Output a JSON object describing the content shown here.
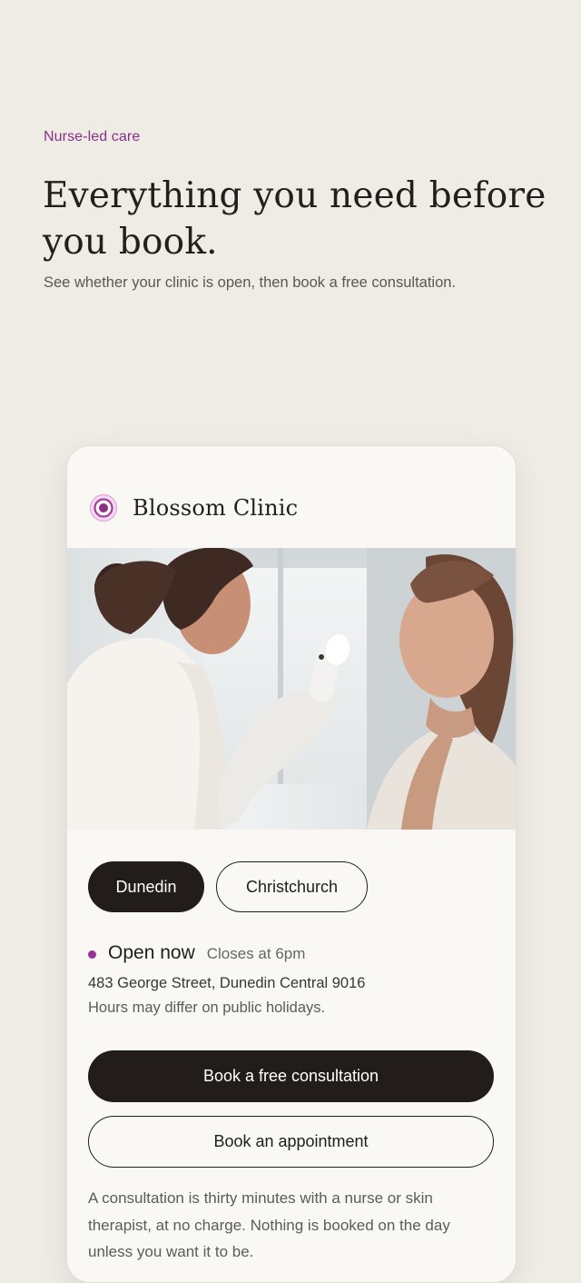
{
  "hero": {
    "eyebrow": "Nurse-led care",
    "headline": "Everything you need before you book.",
    "subline": "See whether your clinic is open, then book a free consultation."
  },
  "clinic": {
    "name": "Blossom Clinic",
    "logo_icon": "blossom-logo-icon",
    "photo_description_icon": "consultation-photo",
    "tabs": [
      {
        "label": "Dunedin",
        "active": true
      },
      {
        "label": "Christchurch",
        "active": false
      }
    ],
    "status": {
      "label": "Open now",
      "closes": "Closes at 6pm"
    },
    "address": "483 George Street, Dunedin Central 9016",
    "hours_note": "Hours may differ on public holidays.",
    "primary_cta": "Book a free consultation",
    "secondary_cta": "Book an appointment",
    "note": "A consultation is thirty minutes with a nurse or skin therapist, at no charge. Nothing is booked on the day unless you want it to be."
  },
  "colors": {
    "accent": "#8a2f86",
    "status_dot": "#9c2f97",
    "button_dark": "#221d1b",
    "page_bg": "#efece6",
    "card_bg": "#f9f8f5"
  }
}
